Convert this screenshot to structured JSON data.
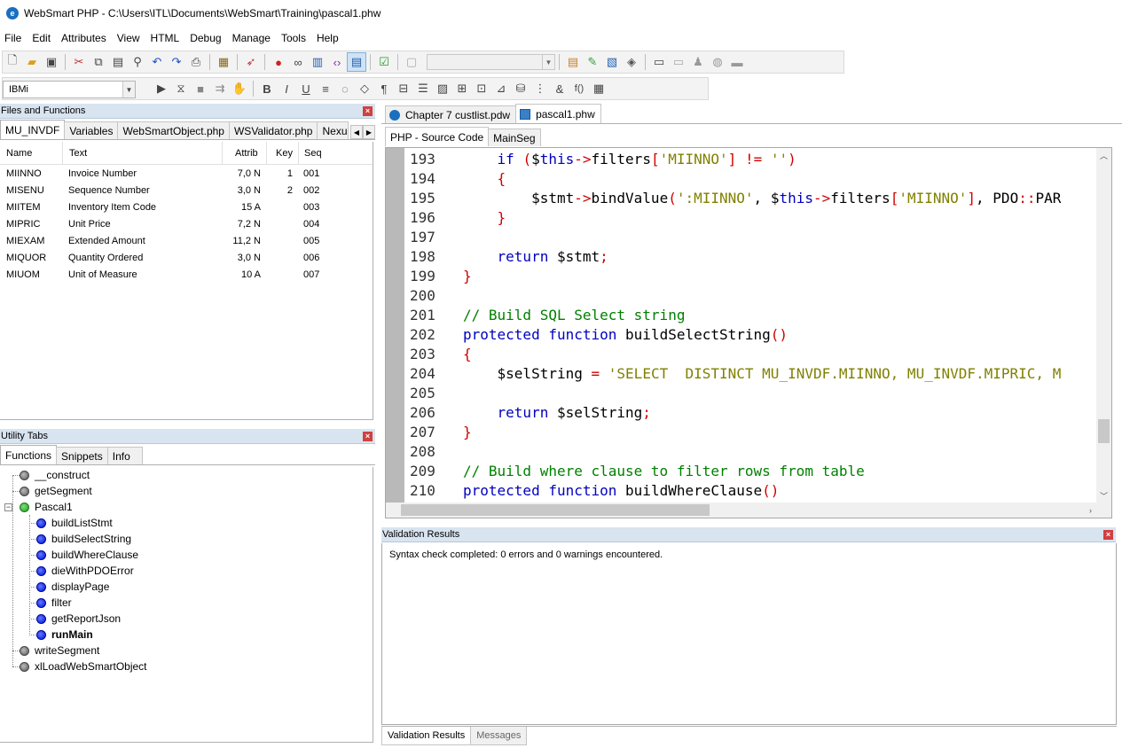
{
  "window": {
    "title": "WebSmart PHP - C:\\Users\\ITL\\Documents\\WebSmart\\Training\\pascal1.phw"
  },
  "menu": [
    "File",
    "Edit",
    "Attributes",
    "View",
    "HTML",
    "Debug",
    "Manage",
    "Tools",
    "Help"
  ],
  "toolbar": {
    "platform_value": "IBMi"
  },
  "files_panel": {
    "title": "Files and Functions",
    "tabs": [
      "MU_INVDF",
      "Variables",
      "WebSmartObject.php",
      "WSValidator.php",
      "Nexus"
    ],
    "columns": [
      "Name",
      "Text",
      "Attrib",
      "Key",
      "Seq"
    ],
    "rows": [
      {
        "name": "MIINNO",
        "text": "Invoice Number",
        "attrib": "7,0 N",
        "key": "1",
        "seq": "001"
      },
      {
        "name": "MISENU",
        "text": "Sequence Number",
        "attrib": "3,0 N",
        "key": "2",
        "seq": "002"
      },
      {
        "name": "MIITEM",
        "text": "Inventory Item Code",
        "attrib": "15 A",
        "key": "",
        "seq": "003"
      },
      {
        "name": "MIPRIC",
        "text": "Unit Price",
        "attrib": "7,2 N",
        "key": "",
        "seq": "004"
      },
      {
        "name": "MIEXAM",
        "text": "Extended Amount",
        "attrib": "11,2 N",
        "key": "",
        "seq": "005"
      },
      {
        "name": "MIQUOR",
        "text": "Quantity Ordered",
        "attrib": "3,0 N",
        "key": "",
        "seq": "006"
      },
      {
        "name": "MIUOM",
        "text": "Unit of Measure",
        "attrib": "10 A",
        "key": "",
        "seq": "007"
      }
    ]
  },
  "utility_panel": {
    "title": "Utility Tabs",
    "tabs": [
      "Functions",
      "Snippets",
      "Info"
    ],
    "tree": [
      {
        "label": "__construct"
      },
      {
        "label": "getSegment"
      },
      {
        "label": "Pascal1"
      },
      {
        "label": "buildListStmt"
      },
      {
        "label": "buildSelectString"
      },
      {
        "label": "buildWhereClause"
      },
      {
        "label": "dieWithPDOError"
      },
      {
        "label": "displayPage"
      },
      {
        "label": "filter"
      },
      {
        "label": "getReportJson"
      },
      {
        "label": "runMain"
      },
      {
        "label": "writeSegment"
      },
      {
        "label": "xlLoadWebSmartObject"
      }
    ]
  },
  "document_tabs": [
    "Chapter 7 custlist.pdw",
    "pascal1.phw"
  ],
  "sub_tabs": [
    "PHP - Source Code",
    "MainSeg"
  ],
  "editor": {
    "line_numbers": [
      "193",
      "194",
      "195",
      "196",
      "197",
      "198",
      "199",
      "200",
      "201",
      "202",
      "203",
      "204",
      "205",
      "206",
      "207",
      "208",
      "209",
      "210"
    ]
  },
  "validation": {
    "title": "Validation Results",
    "message": "Syntax check completed: 0 errors and 0 warnings encountered.",
    "tabs": [
      "Validation Results",
      "Messages"
    ]
  }
}
